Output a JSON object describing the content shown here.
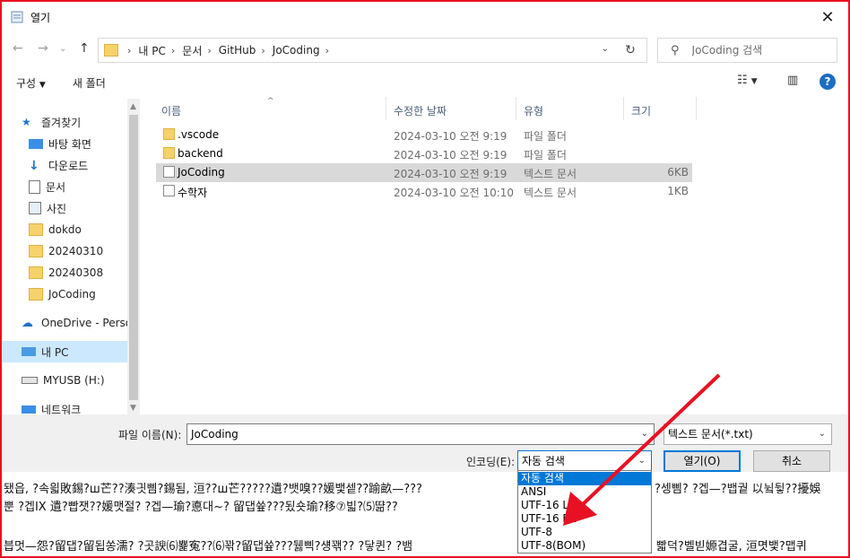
{
  "window": {
    "title": "열기"
  },
  "nav": {
    "breadcrumb": [
      "내 PC",
      "문서",
      "GitHub",
      "JoCoding"
    ],
    "search_placeholder": "JoCoding 검색"
  },
  "toolbar": {
    "organize": "구성",
    "new_folder": "새 폴더"
  },
  "sidebar": {
    "items": [
      {
        "label": "즐겨찾기",
        "icon": "star-icon"
      },
      {
        "label": "바탕 화면",
        "icon": "desktop-icon",
        "pinned": true
      },
      {
        "label": "다운로드",
        "icon": "download-icon",
        "pinned": true
      },
      {
        "label": "문서",
        "icon": "document-icon",
        "pinned": true
      },
      {
        "label": "사진",
        "icon": "pictures-icon",
        "pinned": true
      },
      {
        "label": "dokdo",
        "icon": "folder-icon",
        "pinned": true
      },
      {
        "label": "20240310",
        "icon": "folder-icon",
        "pinned": true
      },
      {
        "label": "20240308",
        "icon": "folder-icon"
      },
      {
        "label": "JoCoding",
        "icon": "folder-icon"
      },
      {
        "label": "OneDrive - Person",
        "icon": "onedrive-icon"
      },
      {
        "label": "내 PC",
        "icon": "pc-icon",
        "selected": true
      },
      {
        "label": "MYUSB (H:)",
        "icon": "usb-drive-icon"
      },
      {
        "label": "네트워크",
        "icon": "network-icon"
      }
    ]
  },
  "columns": {
    "name": "이름",
    "modified": "수정한 날짜",
    "type": "유형",
    "size": "크기"
  },
  "files": [
    {
      "name": ".vscode",
      "modified": "2024-03-10 오전 9:19",
      "type": "파일 폴더",
      "size": "",
      "kind": "folder"
    },
    {
      "name": "backend",
      "modified": "2024-03-10 오전 9:19",
      "type": "파일 폴더",
      "size": "",
      "kind": "folder"
    },
    {
      "name": "JoCoding",
      "modified": "2024-03-10 오전 9:19",
      "type": "텍스트 문서",
      "size": "6KB",
      "kind": "doc",
      "selected": true
    },
    {
      "name": "수학자",
      "modified": "2024-03-10 오전 10:10",
      "type": "텍스트 문서",
      "size": "1KB",
      "kind": "doc"
    }
  ],
  "footer": {
    "filename_label": "파일 이름(N):",
    "filename_value": "JoCoding",
    "filetype_value": "텍스트 문서(*.txt)",
    "encoding_label": "인코딩(E):",
    "encoding_value": "자동 검색",
    "open_button": "열기(O)",
    "cancel_button": "취소"
  },
  "encoding_options": [
    "자동 검색",
    "ANSI",
    "UTF-16 LE",
    "UTF-16 BE",
    "UTF-8",
    "UTF-8(BOM)"
  ],
  "background_text": {
    "line1": "됐읍, ?속읣敗錫?ш芒??湊긧삠?錫됨, 洹??ш芒?????遺?뱃嗅??媛뱇셑??踰畝—???",
    "line1b": "?셍삠? ?겝—?뱁궡 以뉰뒿??擾娛",
    "line2": "뿐 ?겝IX 遺?빱잿??媛맷절? ?겝—瑜?悳대~? 留댑쓮???됬숏瑜?移⑦빏?⑸땲??",
    "line3": "븝멋—怨?留댑?留됩쏭濡? ?곳諛⑹뾽寃??⑹꽊?留댑쓮???뒗삑?섕꽦?? ?닿퀸? ?뱀",
    "line3b": "빫덕?벨빋嫄겹굴, 洹몃뱇?맵퀴"
  },
  "colors": {
    "accent": "#0078d7",
    "frame": "#e81123",
    "arrow": "#e81123"
  }
}
